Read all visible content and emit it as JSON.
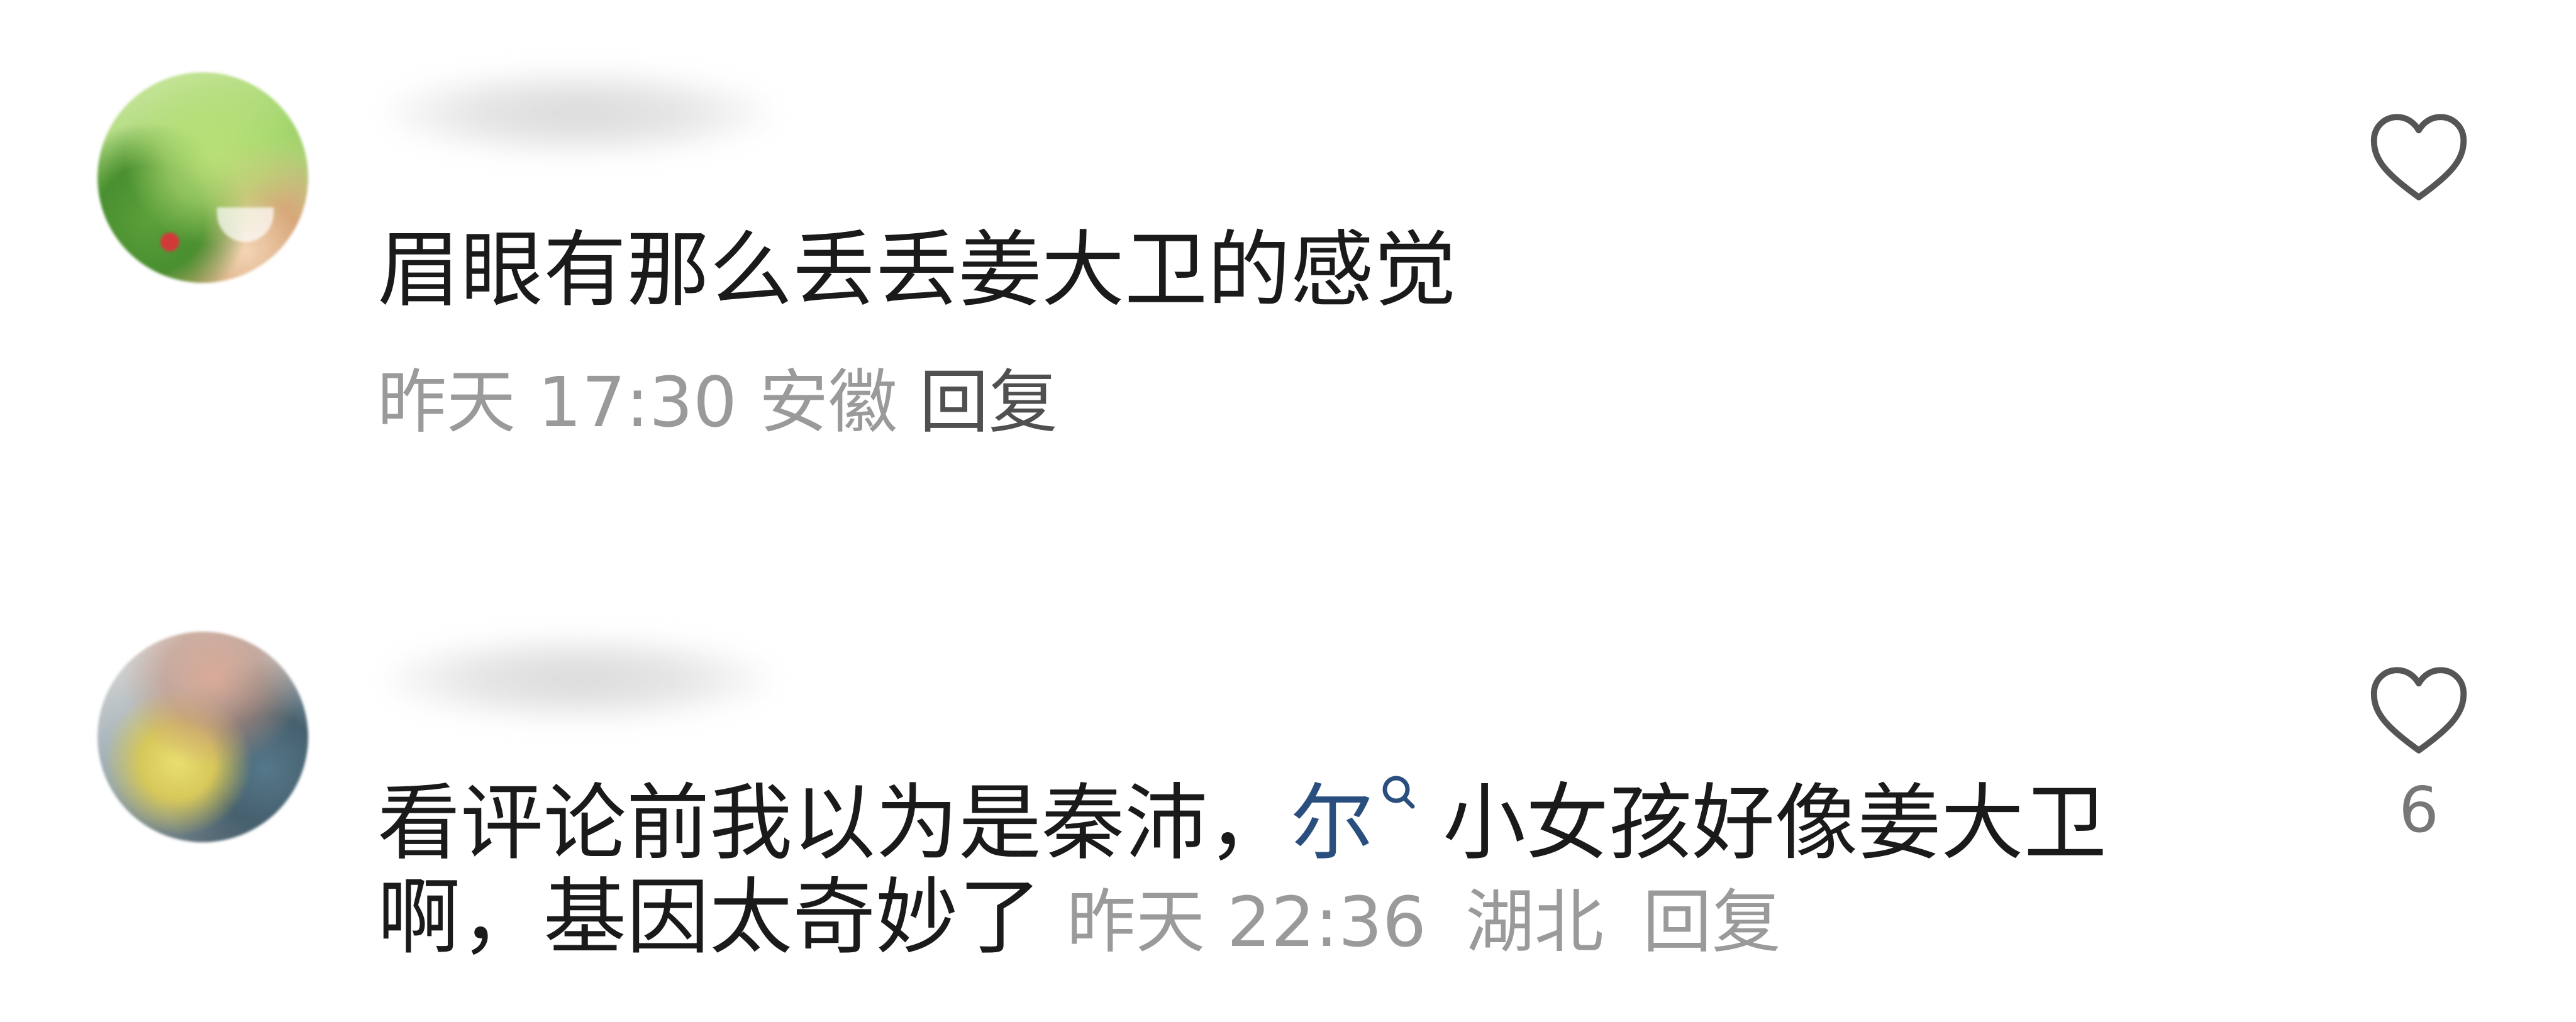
{
  "comments": [
    {
      "text": "眉眼有那么丢丢姜大卫的感觉",
      "time": "昨天 17:30",
      "location": "安徽",
      "reply_label": "回复",
      "likes": ""
    },
    {
      "text_before_link": "看评论前我以为是秦沛，",
      "link_text": "尔",
      "text_after_link": "小女孩好像姜大卫啊，基因太奇妙了",
      "time": "昨天 22:36",
      "location": "湖北",
      "reply_label": "回复",
      "likes": "6"
    }
  ],
  "icons": {
    "like": "heart-outline-icon",
    "search": "search-icon"
  },
  "colors": {
    "text": "#1a1a1a",
    "meta": "#9a9a9a",
    "link": "#2a4f7e",
    "icon": "#555555"
  }
}
